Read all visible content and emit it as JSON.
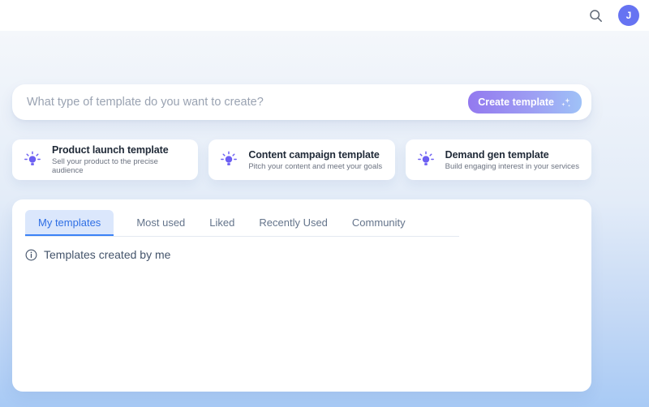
{
  "header": {
    "avatar_initial": "J"
  },
  "prompt_bar": {
    "placeholder": "What type of template do you want to create?",
    "create_button_label": "Create template"
  },
  "suggestion_cards": [
    {
      "title": "Product launch template",
      "subtitle": "Sell your product to the precise audience"
    },
    {
      "title": "Content campaign template",
      "subtitle": "Pitch your content and meet your goals"
    },
    {
      "title": "Demand gen template",
      "subtitle": "Build engaging interest in your services"
    }
  ],
  "templates_panel": {
    "tabs": [
      {
        "label": "My templates"
      },
      {
        "label": "Most used"
      },
      {
        "label": "Liked"
      },
      {
        "label": "Recently Used"
      },
      {
        "label": "Community"
      }
    ],
    "active_tab": "My templates",
    "empty_message": "Templates created by me"
  },
  "colors": {
    "accent_blue": "#3b82f6",
    "avatar_bg": "#6673f2",
    "button_gradient_start": "#9379ef",
    "button_gradient_end": "#9fc2f7",
    "bulb_icon": "#6c5ff2",
    "background_top": "#f4f7fb",
    "background_bottom": "#a8caf5"
  }
}
